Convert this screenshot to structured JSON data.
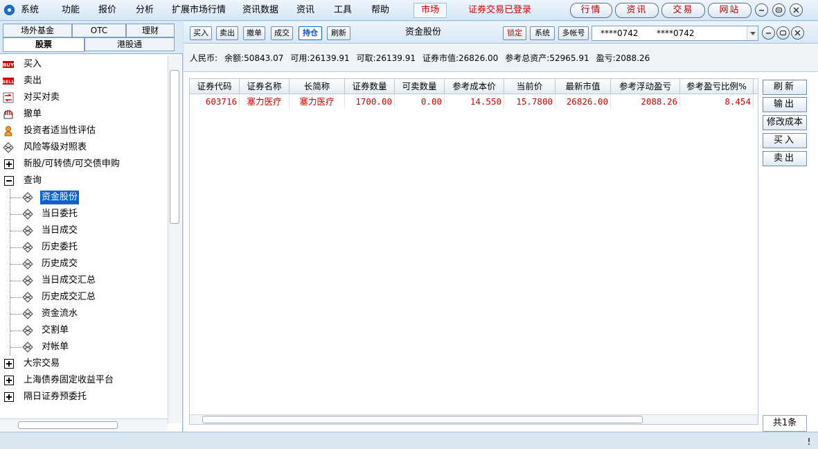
{
  "menu": {
    "items": [
      "系统",
      "功能",
      "报价",
      "分析",
      "扩展市场行情",
      "资讯数据",
      "资讯",
      "工具",
      "帮助"
    ],
    "market": "市场",
    "status": "证券交易已登录",
    "tabs": [
      "行情",
      "资讯",
      "交易",
      "网站"
    ]
  },
  "left": {
    "tabs_row1": [
      "场外基金",
      "OTC",
      "理财"
    ],
    "tabs_row2": [
      "股票",
      "港股通"
    ],
    "tree": [
      {
        "label": "买入",
        "icon": "buy-icon"
      },
      {
        "label": "卖出",
        "icon": "sell-icon"
      },
      {
        "label": "对买对卖",
        "icon": "swap-icon"
      },
      {
        "label": "撤单",
        "icon": "cancel-hand-icon"
      },
      {
        "label": "投资者适当性评估",
        "icon": "assessment-icon"
      },
      {
        "label": "风险等级对照表",
        "icon": "diamond-icon"
      },
      {
        "label": "新股/可转债/可交债申购",
        "icon": "expand-icon"
      },
      {
        "label": "查询",
        "icon": "collapse-icon"
      }
    ],
    "query_children": [
      "资金股份",
      "当日委托",
      "当日成交",
      "历史委托",
      "历史成交",
      "当日成交汇总",
      "历史成交汇总",
      "资金流水",
      "交割单",
      "对帐单"
    ],
    "tree_tail": [
      "大宗交易",
      "上海债券固定收益平台",
      "隔日证券预委托"
    ]
  },
  "toolbar": {
    "buttons": [
      "买入",
      "卖出",
      "撤单",
      "成交",
      "持仓",
      "刷新"
    ],
    "title": "资金股份",
    "lock": "锁定",
    "system": "系统",
    "multi": "多帐号",
    "account1": "****0742",
    "account2": "****0742"
  },
  "summary": {
    "currency": "人民币:",
    "balance": "余额:50843.07",
    "available": "可用:26139.91",
    "withdrawable": "可取:26139.91",
    "market_value": "证券市值:26826.00",
    "total_assets": "参考总资产:52965.91",
    "pnl": "盈亏:2088.26"
  },
  "table": {
    "headers": [
      "证券代码",
      "证券名称",
      "长简称",
      "证券数量",
      "可卖数量",
      "参考成本价",
      "当前价",
      "最新市值",
      "参考浮动盈亏",
      "参考盈亏比例%"
    ],
    "rows": [
      [
        "603716",
        "塞力医疗",
        "塞力医疗",
        "1700.00",
        "0.00",
        "14.550",
        "15.7800",
        "26826.00",
        "2088.26",
        "8.454"
      ]
    ]
  },
  "side_buttons": [
    "刷新",
    "输出",
    "修改成本",
    "买入",
    "卖出"
  ],
  "count": "共1条",
  "colors": {
    "accent": "#0a64c8",
    "red": "#d60000"
  }
}
